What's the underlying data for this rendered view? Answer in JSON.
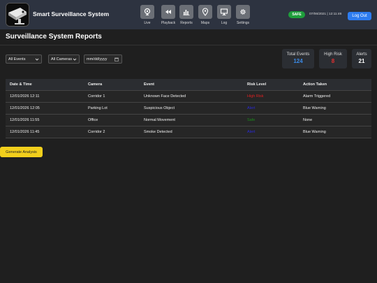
{
  "app": {
    "title": "Smart Surveillance System"
  },
  "nav": [
    {
      "label": "Live",
      "icon": "webcam-icon"
    },
    {
      "label": "Playback",
      "icon": "rewind-icon"
    },
    {
      "label": "Reports",
      "icon": "bar-chart-icon"
    },
    {
      "label": "Maps",
      "icon": "map-pin-icon"
    },
    {
      "label": "Log",
      "icon": "monitor-icon"
    },
    {
      "label": "Settings",
      "icon": "gear-icon"
    }
  ],
  "status": {
    "badge": "SAFE",
    "badge_color": "#1e9e3b",
    "datetime": "07/06/2021 | 12:11:46"
  },
  "logout_label": "Log Out",
  "page_title": "Surveillance System Reports",
  "filters": {
    "events": "All Events",
    "cameras": "All Cameras",
    "date_placeholder": "mm/dd/yyyy"
  },
  "stats": [
    {
      "label": "Total Events",
      "value": "124",
      "color": "#3b8be8"
    },
    {
      "label": "High Risk",
      "value": "8",
      "color": "#e03030"
    },
    {
      "label": "Alerts",
      "value": "21",
      "color": "#ffffff"
    }
  ],
  "table": {
    "headers": [
      "Date & Time",
      "Camera",
      "Event",
      "Risk Level",
      "Action Taken"
    ],
    "rows": [
      {
        "datetime": "12/01/2026 12:11",
        "camera": "Corridor 1",
        "event": "Unknown Face Detected",
        "risk": "High Risk",
        "risk_color": "#e02020",
        "action": "Alarm Triggered"
      },
      {
        "datetime": "12/01/2026 12:05",
        "camera": "Parking Lot",
        "event": "Suspicious Object",
        "risk": "Alert",
        "risk_color": "#2a2ad8",
        "action": "Blue Warning"
      },
      {
        "datetime": "12/01/2026 11:55",
        "camera": "Office",
        "event": "Normal Movement",
        "risk": "Safe",
        "risk_color": "#1c8a1c",
        "action": "None"
      },
      {
        "datetime": "12/01/2026 11:45",
        "camera": "Corridor 2",
        "event": "Smoke Detected",
        "risk": "Alert",
        "risk_color": "#2a2ad8",
        "action": "Blue Warning"
      }
    ]
  },
  "generate_label": "Generate Analysis",
  "colors": {
    "accent": "#2d7cf0",
    "generate": "#f2cf1c"
  }
}
